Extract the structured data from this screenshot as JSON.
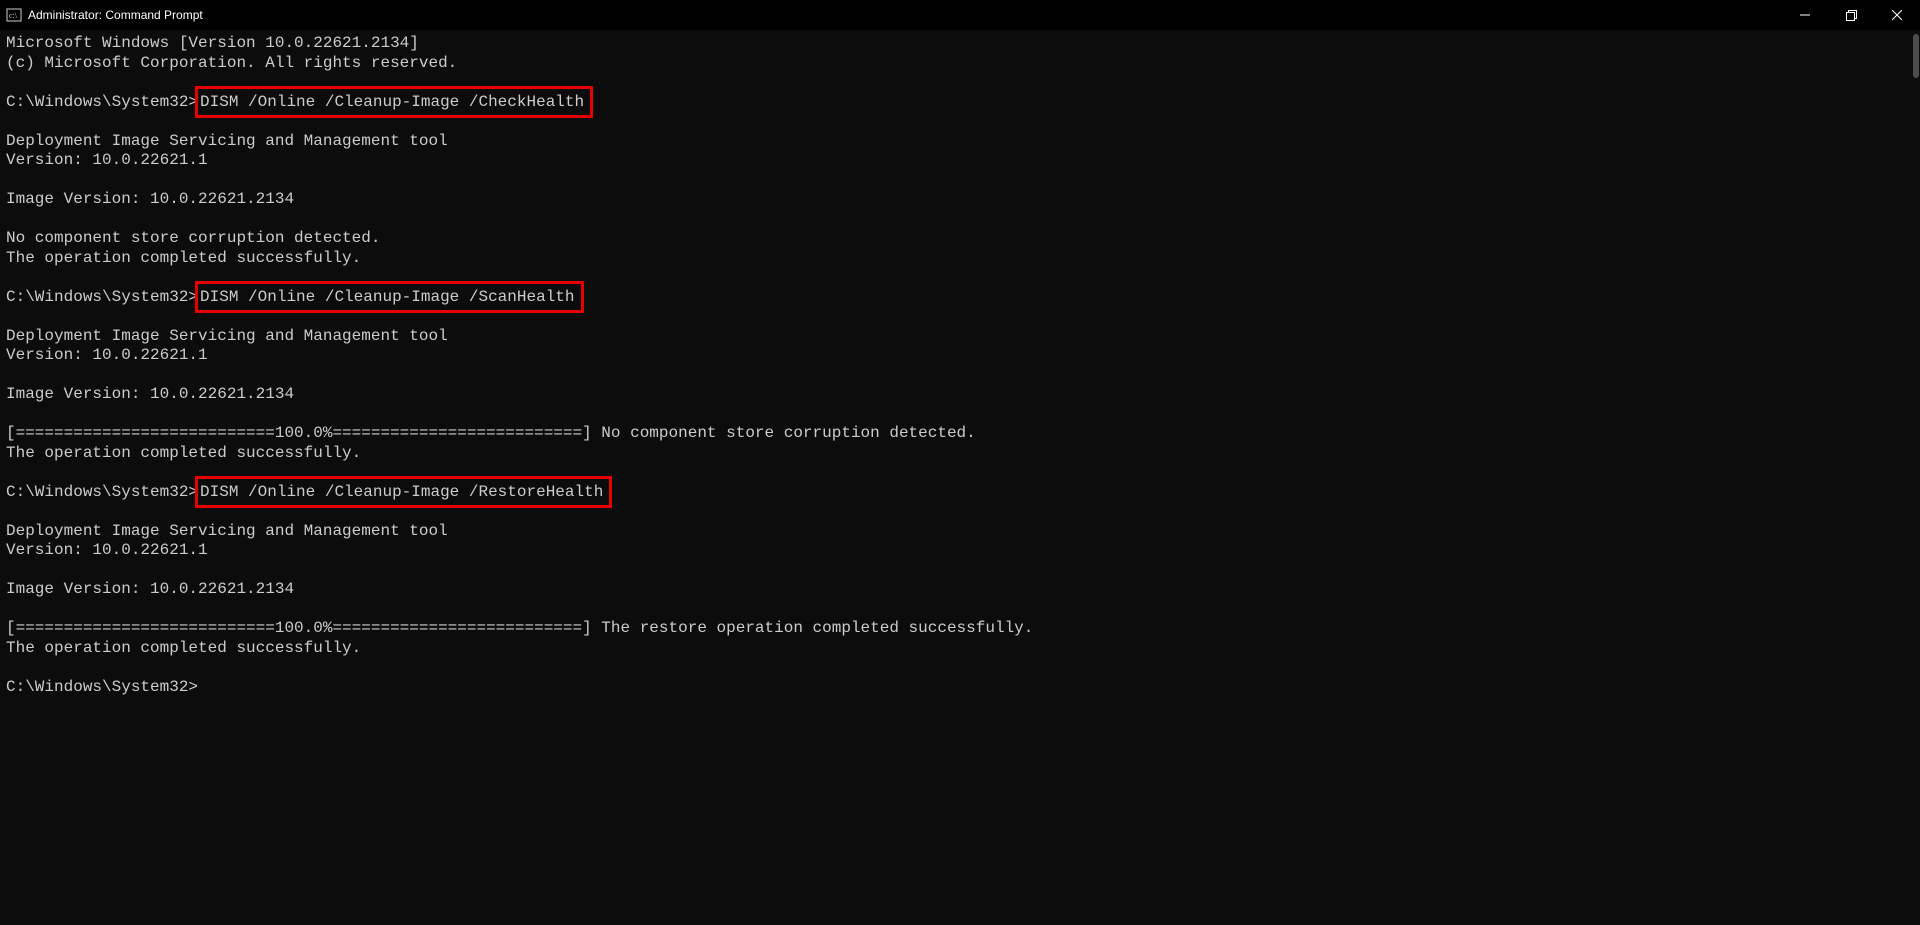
{
  "window": {
    "title": "Administrator: Command Prompt"
  },
  "prompt": "C:\\Windows\\System32>",
  "commands": {
    "cmd1": "DISM /Online /Cleanup-Image /CheckHealth",
    "cmd2": "DISM /Online /Cleanup-Image /ScanHealth",
    "cmd3": "DISM /Online /Cleanup-Image /RestoreHealth"
  },
  "lines": {
    "l1": "Microsoft Windows [Version 10.0.22621.2134]",
    "l2": "(c) Microsoft Corporation. All rights reserved.",
    "blank": " ",
    "dism_tool": "Deployment Image Servicing and Management tool",
    "dism_ver": "Version: 10.0.22621.1",
    "img_ver": "Image Version: 10.0.22621.2134",
    "no_corrupt": "No component store corruption detected.",
    "op_success": "The operation completed successfully.",
    "progress_scan": "[===========================100.0%==========================] No component store corruption detected.",
    "progress_restore": "[===========================100.0%==========================] The restore operation completed successfully."
  }
}
